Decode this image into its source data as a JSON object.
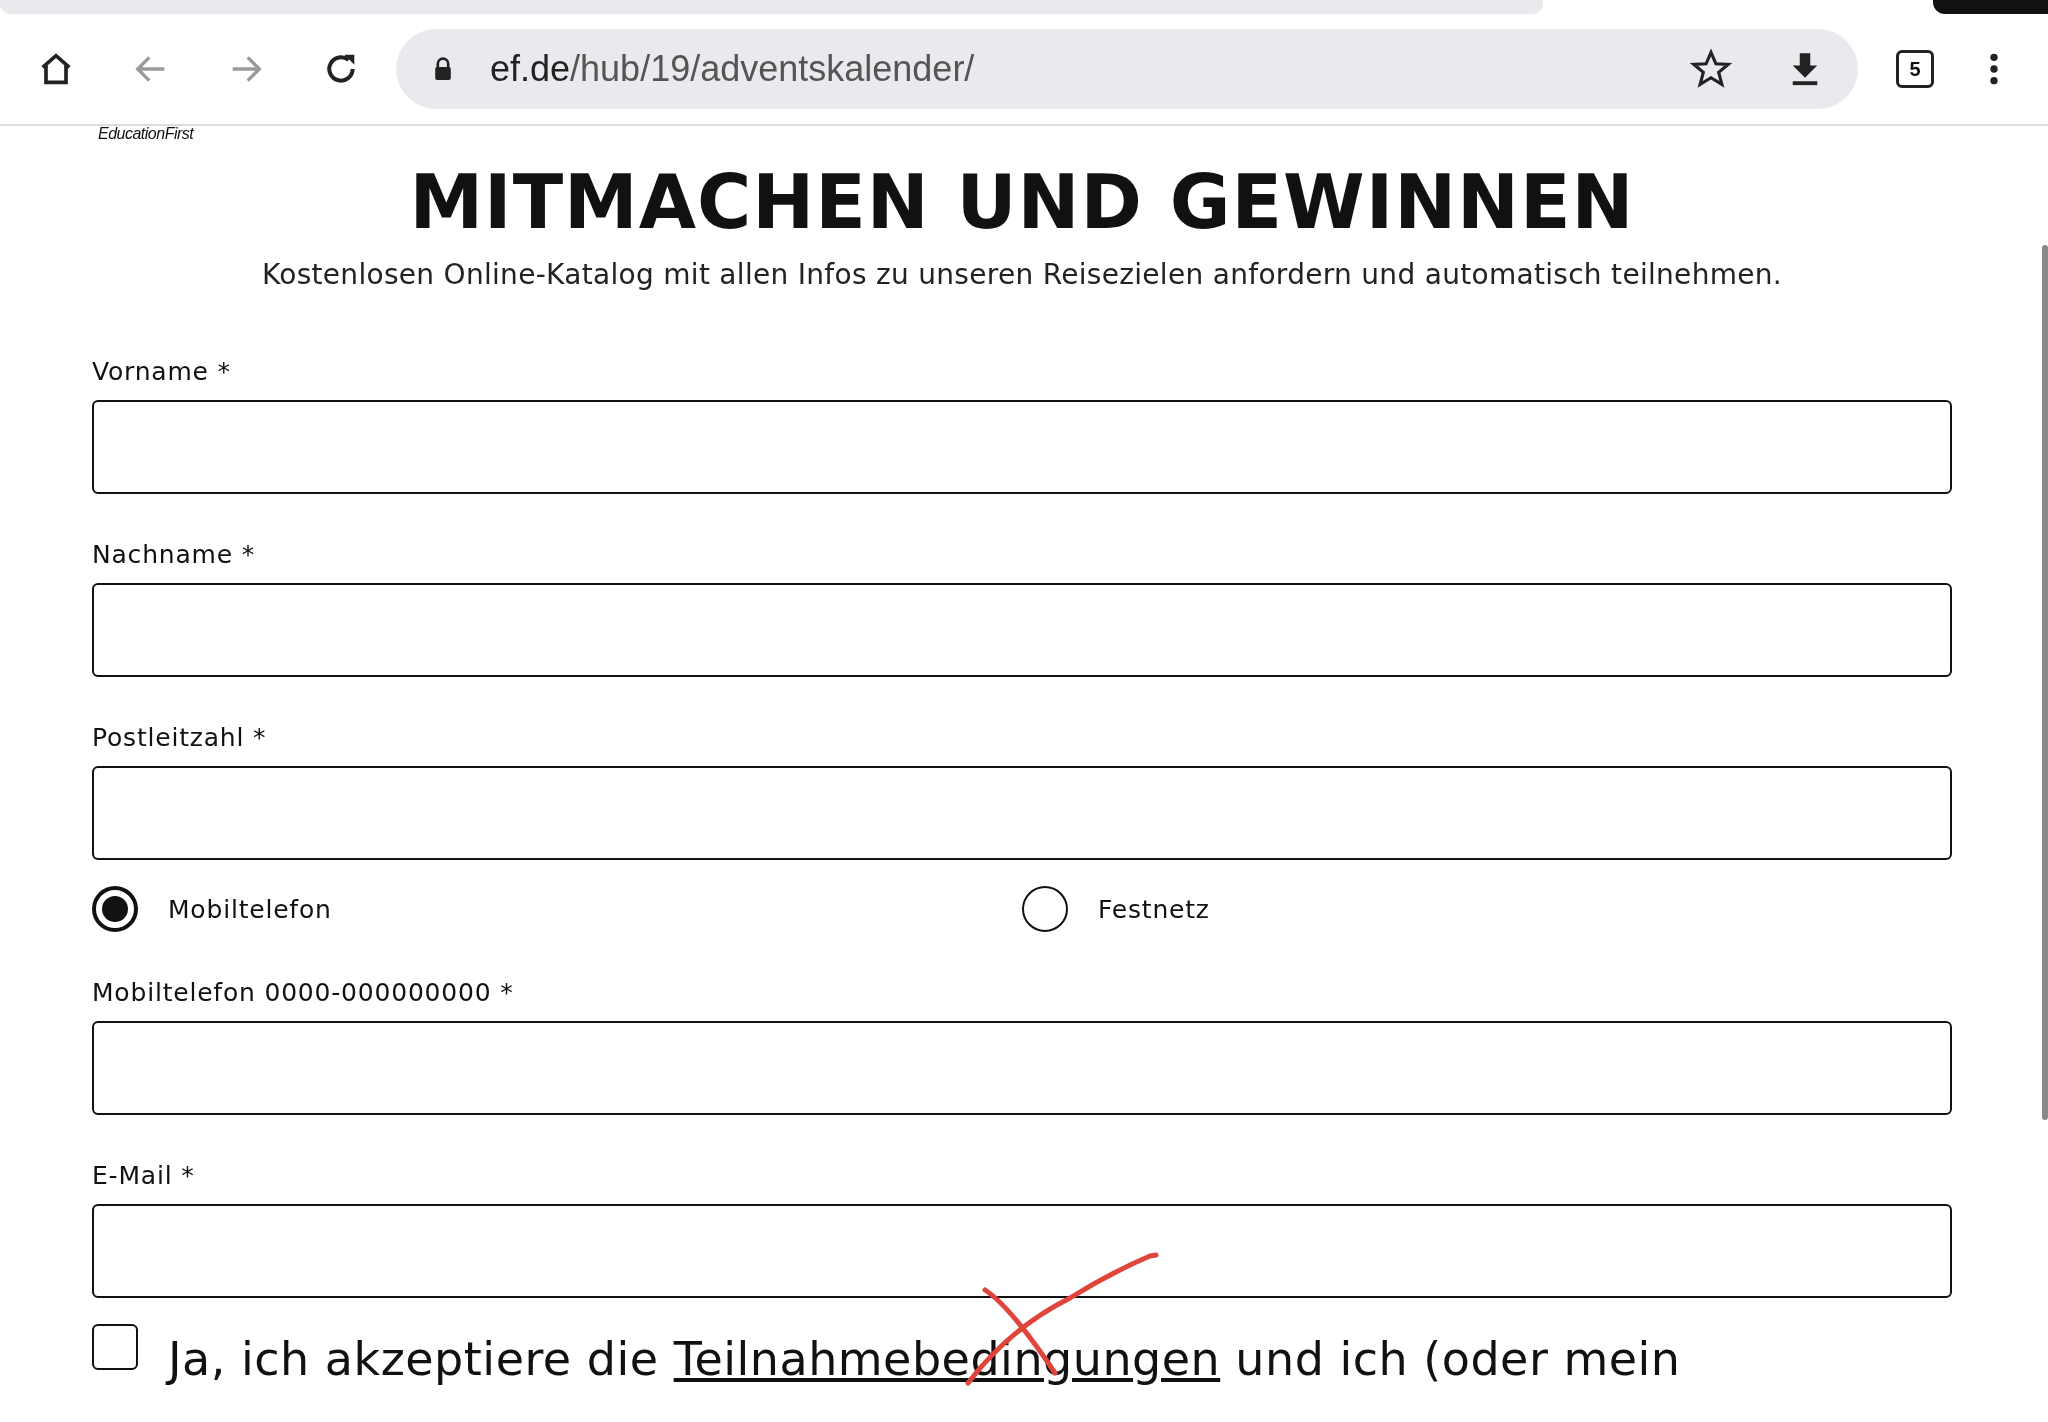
{
  "browser": {
    "url_domain": "ef.de",
    "url_path": "/hub/19/adventskalender/",
    "tab_count": "5"
  },
  "logo_text": "EducationFirst",
  "heading": "MITMACHEN UND GEWINNEN",
  "subtitle": "Kostenlosen Online-Katalog mit allen Infos zu unseren Reisezielen anfordern und automatisch teilnehmen.",
  "fields_top": [
    {
      "label": "Vorname *"
    },
    {
      "label": "Nachname *"
    },
    {
      "label": "Postleitzahl *"
    }
  ],
  "phone_type": [
    {
      "label": "Mobiltelefon",
      "selected": true
    },
    {
      "label": "Festnetz",
      "selected": false
    }
  ],
  "fields_bottom": [
    {
      "label": "Mobiltelefon 0000-000000000 *"
    },
    {
      "label": "E-Mail *"
    }
  ],
  "consent": {
    "checked": false,
    "before": "Ja, ich akzeptiere die ",
    "link": "Teilnahmebedingungen",
    "after": " und ich (oder mein"
  }
}
